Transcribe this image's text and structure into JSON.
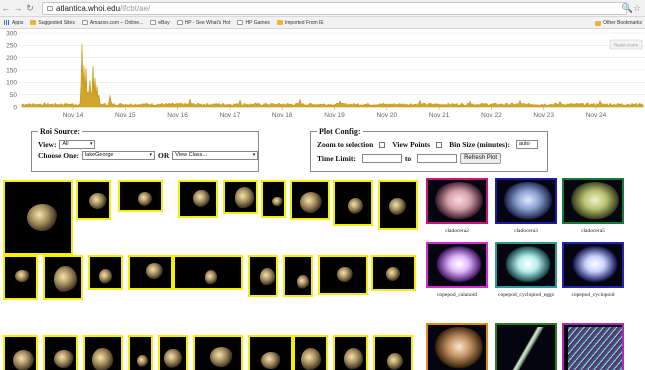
{
  "browser": {
    "url_host": "atlantica.whoi.edu",
    "url_path": "/ifcbt/ae/",
    "bookmarks": [
      {
        "label": "Apps",
        "icon": "apps"
      },
      {
        "label": "Suggested Sites",
        "icon": "folder"
      },
      {
        "label": "Amazon.com – Online...",
        "icon": "page"
      },
      {
        "label": "eBay",
        "icon": "page"
      },
      {
        "label": "HP - See What's Hot",
        "icon": "page"
      },
      {
        "label": "HP Games",
        "icon": "page"
      },
      {
        "label": "Imported From IE",
        "icon": "folder"
      }
    ],
    "other_bookmarks": "Other Bookmarks"
  },
  "plot": {
    "y_ticks": [
      "300",
      "250",
      "200",
      "150",
      "100",
      "50",
      "0"
    ],
    "x_ticks": [
      "Nov 14",
      "Nov 15",
      "Nov 16",
      "Nov 17",
      "Nov 18",
      "Nov 19",
      "Nov 20",
      "Nov 21",
      "Nov 22",
      "Nov 23",
      "Nov 24"
    ],
    "reset_label": "Reset zoom",
    "line_color": "#c8960a",
    "grid_color": "#e8e8e8"
  },
  "roi_source": {
    "legend": "Roi Source:",
    "view_label": "View:",
    "view_value": "All",
    "choose_label": "Choose One:",
    "choose_value": "lakeGeorge",
    "or_label": "OR",
    "class_value": "View Class..."
  },
  "plot_config": {
    "legend": "Plot Config:",
    "zoom_label": "Zoom to selection",
    "view_points_label": "View Points",
    "bin_label": "Bin Size (minutes):",
    "bin_value": "auto",
    "time_limit_label": "Time Limit:",
    "to_label": "to",
    "refresh_label": "Refresh Plot"
  },
  "classes": [
    {
      "label": "cladocera2",
      "border": "#c8157e"
    },
    {
      "label": "cladocera3",
      "border": "#1a1aa8"
    },
    {
      "label": "cladocera5",
      "border": "#127a3a"
    },
    {
      "label": "copepod_calanoid",
      "border": "#d42bd4"
    },
    {
      "label": "copepod_cyclopiod_eggs",
      "border": "#2b9a9a"
    },
    {
      "label": "copepod_cyclopoid",
      "border": "#2323b3"
    },
    {
      "label": "",
      "border": "#e08a1a"
    },
    {
      "label": "",
      "border": "#2a7a2a"
    },
    {
      "label": "",
      "border": "#b12bb1"
    }
  ],
  "colors": {
    "thumb_border": "#f4f000",
    "panel_border": "#8a8a8a"
  }
}
